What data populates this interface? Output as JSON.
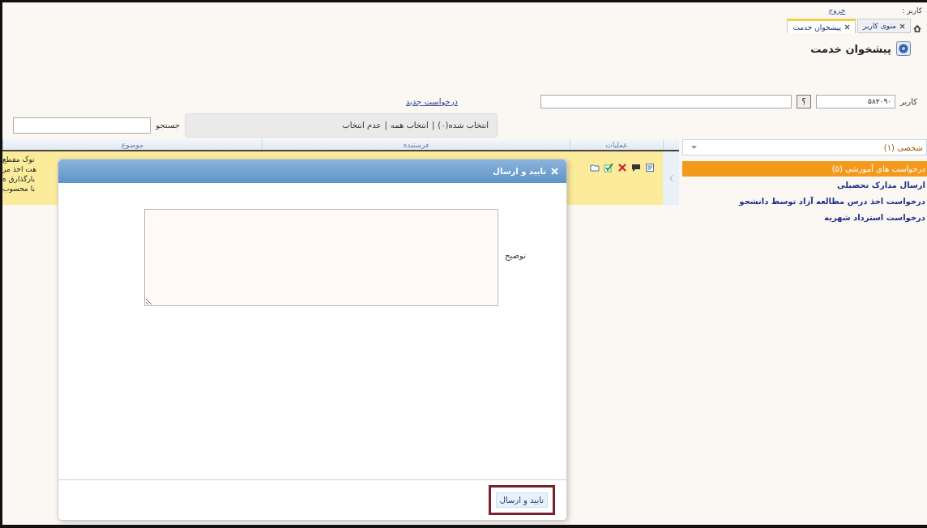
{
  "user_bar": {
    "user_label": "کاربر :",
    "logout": "خروج"
  },
  "tabs": [
    {
      "label": "منوی کاربر",
      "selected": false
    },
    {
      "label": "پیشخوان خدمت",
      "selected": true
    }
  ],
  "page_title": "پیشخوان خدمت",
  "user_field": {
    "label": "کاربر",
    "value": "۵۸۲۰۹۰"
  },
  "help_button": "؟",
  "new_request": "درخواست جدید",
  "selection": {
    "separator": "|",
    "links": [
      "انتخاب شده(۰)",
      "انتخاب همه",
      "عدم انتخاب"
    ]
  },
  "search": {
    "label": "جستجو"
  },
  "table": {
    "columns": [
      "عملیات",
      "فرستنده",
      "موضوع"
    ],
    "rows": [
      {
        "subject_lines": [
          "نوک مقطع",
          "هت اخذ مر",
          "بارگذارق ه",
          "با محسوب"
        ]
      }
    ]
  },
  "sidebar": {
    "dropdown": "شخصی (۱)",
    "items": [
      {
        "label": "درخواست های آموزشی (۵)",
        "selected": true
      },
      {
        "label": "ارسال مدارک تحصیلی",
        "selected": false
      },
      {
        "label": "درخواست اخذ درس مطالعه آزاد توسط دانشجو",
        "selected": false
      },
      {
        "label": "درخواست استرداد شهریه",
        "selected": false
      }
    ]
  },
  "dialog": {
    "title": "تایید و ارسال",
    "field_label": "توضیح",
    "submit": "تایید و ارسال"
  }
}
